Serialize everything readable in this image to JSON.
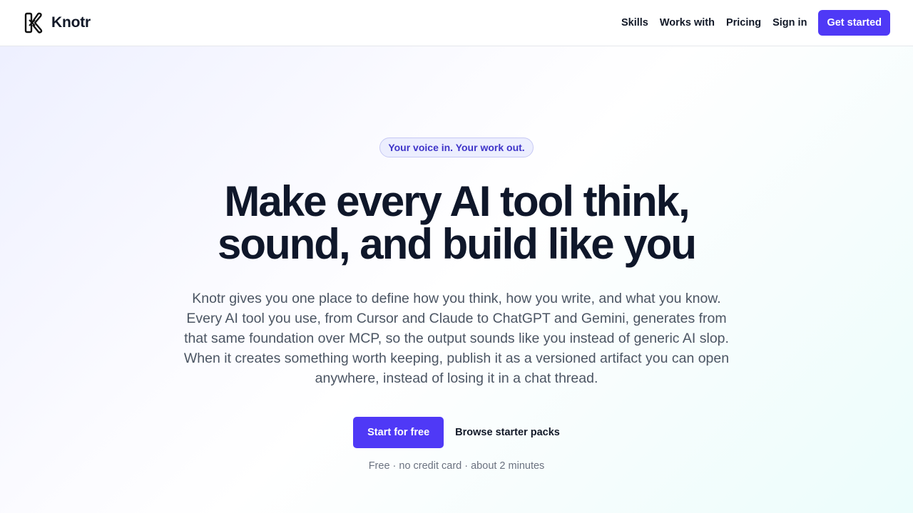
{
  "brand": {
    "name": "Knotr",
    "logo_icon": "knot-k-logo-icon"
  },
  "nav": {
    "links": [
      "Skills",
      "Works with",
      "Pricing",
      "Sign in"
    ],
    "cta_label": "Get started"
  },
  "hero": {
    "tagline": "Your voice in. Your work out.",
    "headline_lines": [
      "Make every AI tool think,",
      "sound, and build like you"
    ],
    "subcopy": "Knotr gives you one place to define how you think, how you write, and what you know. Every AI tool you use, from Cursor and Claude to ChatGPT and Gemini, generates from that same foundation over MCP, so the output sounds like you instead of generic AI slop. When it creates something worth keeping, publish it as a versioned artifact you can open anywhere, instead of losing it in a chat thread.",
    "primary_cta": "Start for free",
    "secondary_cta": "Browse starter packs",
    "fineprint": "Free · no credit card · about 2 minutes"
  },
  "colors": {
    "accent": "#4f39f6",
    "text_primary": "#0f172a",
    "text_secondary": "#4b5563",
    "pill_bg": "#eceefe",
    "pill_text": "#3f35c9"
  }
}
